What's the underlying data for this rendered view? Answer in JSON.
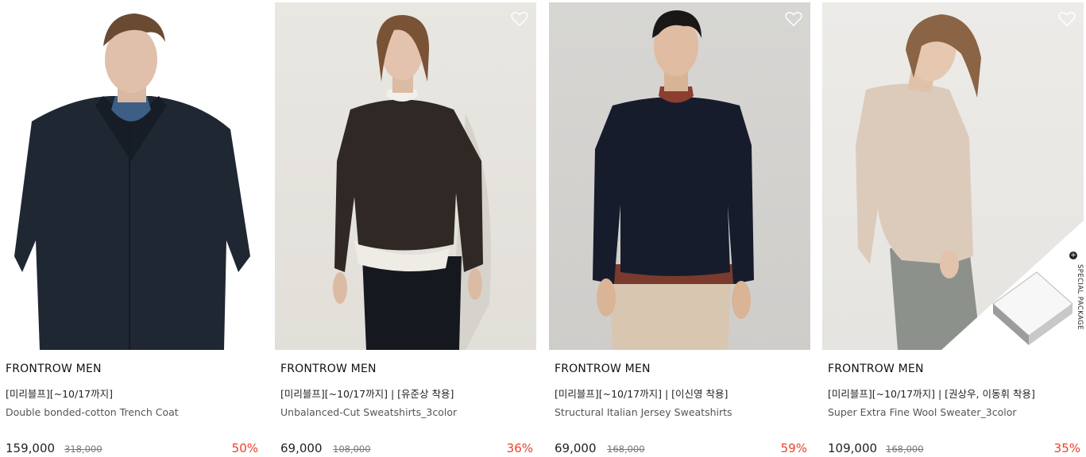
{
  "products": [
    {
      "brand": "FRONTROW MEN",
      "promo": "[미리블프][~10/17까지]",
      "name": "Double bonded-cotton Trench Coat",
      "price": "159,000",
      "original_price": "318,000",
      "discount": "50%",
      "image": "model-navy-trench-coat"
    },
    {
      "brand": "FRONTROW MEN",
      "promo": "[미리블프][~10/17까지] | [유준상 착용]",
      "name": "Unbalanced-Cut Sweatshirts_3color",
      "price": "69,000",
      "original_price": "108,000",
      "discount": "36%",
      "image": "model-brown-sweatshirt"
    },
    {
      "brand": "FRONTROW MEN",
      "promo": "[미리블프][~10/17까지] | [이신영 착용]",
      "name": "Structural Italian Jersey Sweatshirts",
      "price": "69,000",
      "original_price": "168,000",
      "discount": "59%",
      "image": "model-navy-sweatshirt"
    },
    {
      "brand": "FRONTROW MEN",
      "promo": "[미리블프][~10/17까지] | [권상우, 이동휘 착용]",
      "name": "Super Extra Fine Wool Sweater_3color",
      "price": "109,000",
      "original_price": "168,000",
      "discount": "35%",
      "image": "model-beige-sweater",
      "badge": "SPECIAL PACKAGE"
    }
  ],
  "colors": {
    "discount": "#e8412c",
    "heart_outline": "#ffffff"
  },
  "icons": {
    "wishlist": "heart-outline-icon",
    "badge_plus": "plus-icon"
  }
}
